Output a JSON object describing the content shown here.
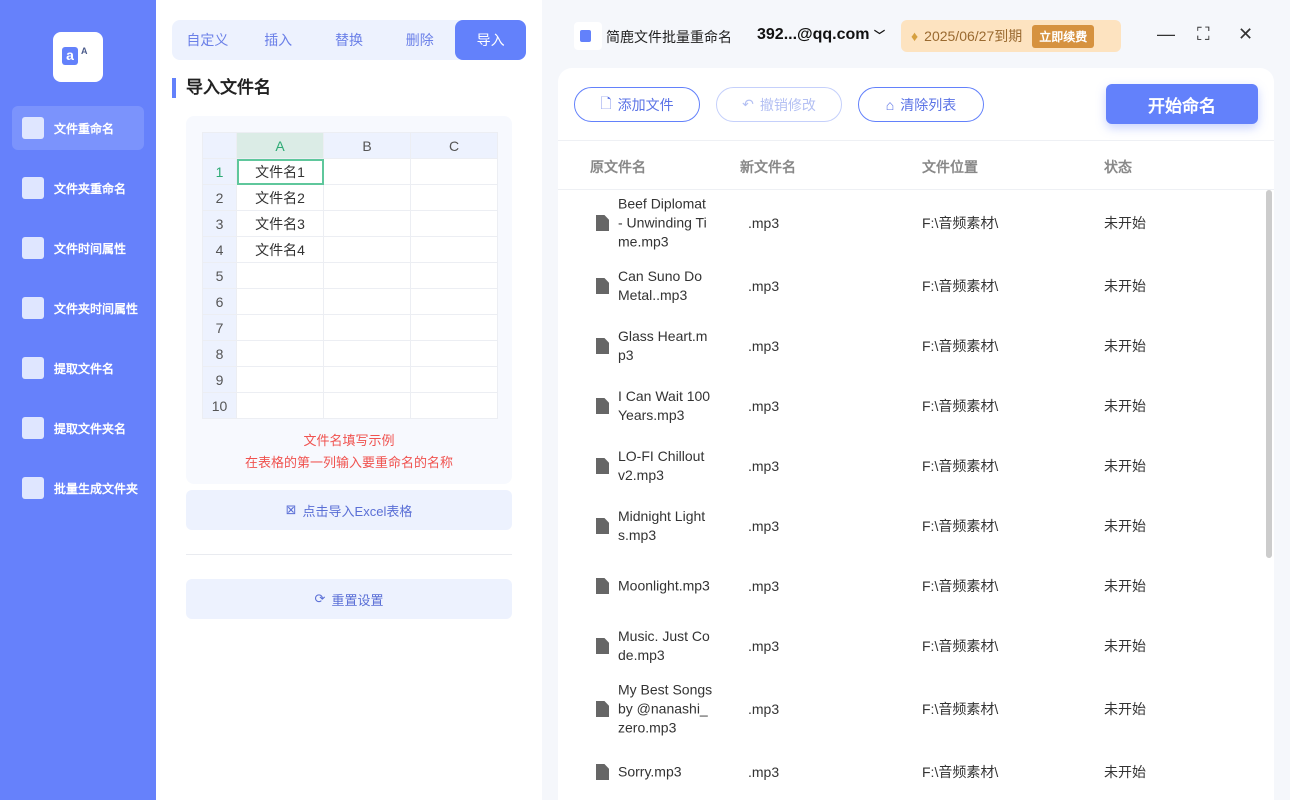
{
  "sidebar": {
    "items": [
      {
        "label": "文件重命名",
        "icon": "file-icon"
      },
      {
        "label": "文件夹重命名",
        "icon": "folder-icon"
      },
      {
        "label": "文件时间属性",
        "icon": "file-clock-icon"
      },
      {
        "label": "文件夹时间属性",
        "icon": "folder-clock-icon"
      },
      {
        "label": "提取文件名",
        "icon": "file-upload-icon"
      },
      {
        "label": "提取文件夹名",
        "icon": "folder-up-icon"
      },
      {
        "label": "批量生成文件夹",
        "icon": "folder-add-icon"
      }
    ]
  },
  "tabs": [
    "自定义",
    "插入",
    "替换",
    "删除",
    "导入"
  ],
  "section_title": "导入文件名",
  "sheet": {
    "columns": [
      "A",
      "B",
      "C"
    ],
    "rows": [
      "1",
      "2",
      "3",
      "4",
      "5",
      "6",
      "7",
      "8",
      "9",
      "10"
    ],
    "values": [
      "文件名1",
      "文件名2",
      "文件名3",
      "文件名4"
    ]
  },
  "hint1": "文件名填写示例",
  "hint2": "在表格的第一列输入要重命名的名称",
  "import_button": "点击导入Excel表格",
  "reset_button": "重置设置",
  "app": {
    "name": "简鹿文件批量重命名",
    "user": "392...@qq.com",
    "expiry": "2025/06/27到期",
    "renew": "立即续费"
  },
  "toolbar": {
    "add": "添加文件",
    "undo": "撤销修改",
    "clear": "清除列表",
    "start": "开始命名"
  },
  "table": {
    "headers": [
      "原文件名",
      "新文件名",
      "文件位置",
      "状态"
    ],
    "rows": [
      {
        "name": "Beef Diplomat - Unwinding Time.mp3",
        "new": ".mp3",
        "loc": "F:\\音频素材\\",
        "status": "未开始"
      },
      {
        "name": "Can Suno Do Metal..mp3",
        "new": ".mp3",
        "loc": "F:\\音频素材\\",
        "status": "未开始"
      },
      {
        "name": "Glass Heart.mp3",
        "new": ".mp3",
        "loc": "F:\\音频素材\\",
        "status": "未开始"
      },
      {
        "name": "I Can Wait 100 Years.mp3",
        "new": ".mp3",
        "loc": "F:\\音频素材\\",
        "status": "未开始"
      },
      {
        "name": "LO-FI Chillout v2.mp3",
        "new": ".mp3",
        "loc": "F:\\音频素材\\",
        "status": "未开始"
      },
      {
        "name": "Midnight Lights.mp3",
        "new": ".mp3",
        "loc": "F:\\音频素材\\",
        "status": "未开始"
      },
      {
        "name": "Moonlight.mp3",
        "new": ".mp3",
        "loc": "F:\\音频素材\\",
        "status": "未开始"
      },
      {
        "name": "Music. Just Code.mp3",
        "new": ".mp3",
        "loc": "F:\\音频素材\\",
        "status": "未开始"
      },
      {
        "name": "My Best Songs by @nanashi_zero.mp3",
        "new": ".mp3",
        "loc": "F:\\音频素材\\",
        "status": "未开始"
      },
      {
        "name": "Sorry.mp3",
        "new": ".mp3",
        "loc": "F:\\音频素材\\",
        "status": "未开始"
      }
    ]
  }
}
